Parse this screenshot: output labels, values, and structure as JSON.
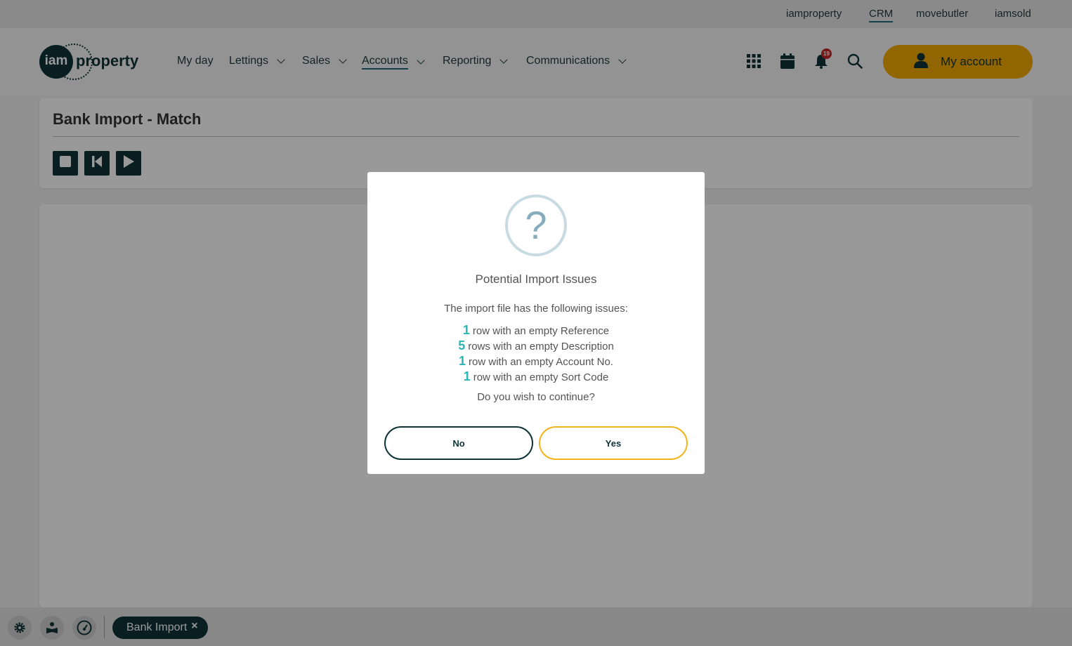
{
  "brand_links": [
    "iamproperty",
    "CRM",
    "movebutler",
    "iamsold"
  ],
  "logo": {
    "circle_text": "iam",
    "text": "property"
  },
  "nav": [
    {
      "label": "My day",
      "dropdown": false
    },
    {
      "label": "Lettings",
      "dropdown": true
    },
    {
      "label": "Sales",
      "dropdown": true
    },
    {
      "label": "Accounts",
      "dropdown": true,
      "active": true
    },
    {
      "label": "Reporting",
      "dropdown": true
    },
    {
      "label": "Communications",
      "dropdown": true
    }
  ],
  "header_icons": [
    "apps-grid-icon",
    "calendar-icon",
    "bell-icon",
    "search-icon"
  ],
  "notifications_count": "19",
  "my_account_label": "My account",
  "page": {
    "title": "Bank Import - Match"
  },
  "toolbar": [
    "stop-icon",
    "skip-back-icon",
    "play-icon"
  ],
  "footer": {
    "tab_label": "Bank Import",
    "tab_close": "×"
  },
  "dialog": {
    "title": "Potential Import Issues",
    "intro": "The import file has the following issues:",
    "issues": [
      {
        "count": "1",
        "text": "row with an empty Reference"
      },
      {
        "count": "5",
        "text": "rows with an empty Description"
      },
      {
        "count": "1",
        "text": "row with an empty Account No."
      },
      {
        "count": "1",
        "text": "row with an empty Sort Code"
      }
    ],
    "question": "Do you wish to continue?",
    "no_label": "No",
    "yes_label": "Yes",
    "icon_glyph": "?"
  },
  "colors": {
    "accent": "#f2a900",
    "dark": "#0e3338",
    "highlight": "#2bb5b5"
  }
}
